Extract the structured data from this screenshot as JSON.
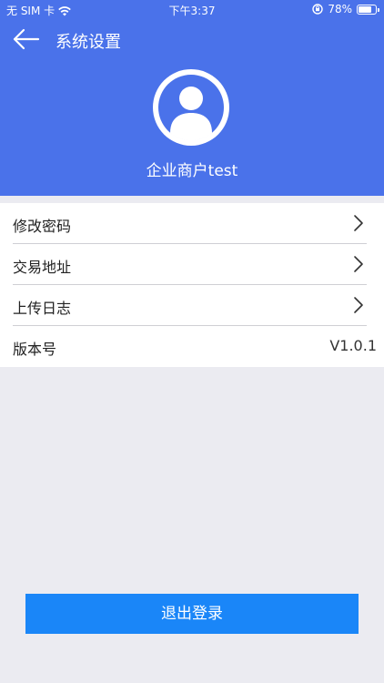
{
  "status_bar": {
    "carrier": "无 SIM 卡",
    "time": "下午3:37",
    "battery": "78%",
    "battery_level": 0.78
  },
  "nav": {
    "back_icon": "arrow-left-icon",
    "title": "系统设置"
  },
  "profile": {
    "avatar_icon": "user-avatar-icon",
    "name": "企业商户test"
  },
  "menu": {
    "items": [
      {
        "label": "修改密码",
        "icon": "chevron-right-icon"
      },
      {
        "label": "交易地址",
        "icon": "chevron-right-icon"
      },
      {
        "label": "上传日志",
        "icon": "chevron-right-icon"
      }
    ],
    "version": {
      "label": "版本号",
      "value": "V1.0.1"
    }
  },
  "logout_button": {
    "label": "退出登录"
  },
  "colors": {
    "header_bg": "#4a72ea",
    "page_bg": "#ebebf1",
    "button_bg": "#1a86f8"
  }
}
